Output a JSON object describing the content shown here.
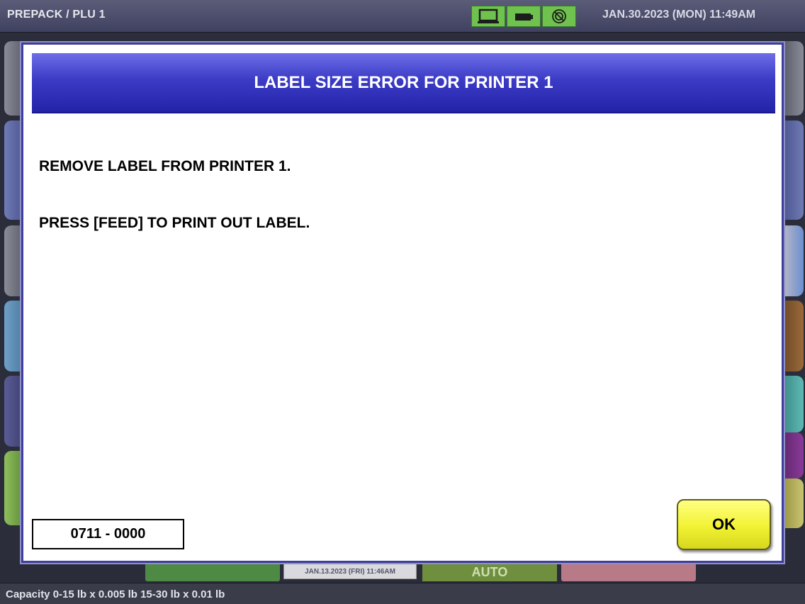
{
  "topbar": {
    "title": "PREPACK / PLU 1",
    "datetime": "JAN.30.2023 (MON)  11:49AM",
    "status_icons": [
      "laptop-icon",
      "battery-icon",
      "network-icon"
    ],
    "status_color": "#6fc24e"
  },
  "dialog": {
    "title": "LABEL SIZE ERROR FOR PRINTER 1",
    "message_line_1": "REMOVE LABEL FROM PRINTER 1.",
    "message_line_2": "PRESS [FEED] TO PRINT OUT LABEL.",
    "error_code": "0711 - 0000",
    "ok_label": "OK",
    "header_color": "#3b3bc6",
    "ok_color": "#f2f233"
  },
  "background": {
    "bottom_date": "JAN.13.2023 (FRI)  11:46AM",
    "bottom_mode": "AUTO"
  },
  "footer": {
    "capacity": "Capacity 0-15 lb x 0.005 lb  15-30 lb x 0.01 lb"
  }
}
